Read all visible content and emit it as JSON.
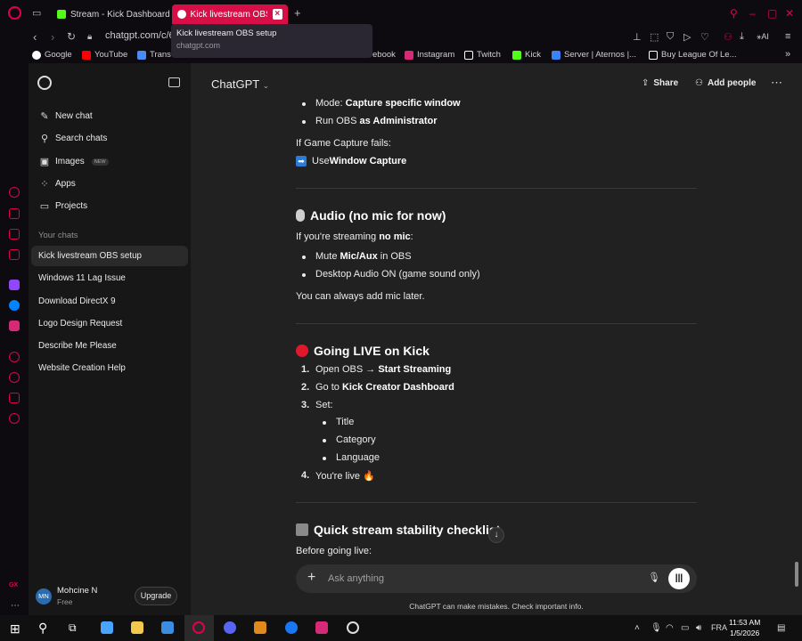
{
  "browser": {
    "tabs": [
      {
        "label": "Stream - Kick Dashboard",
        "favicon": "kick-icon",
        "color": "#53fc18"
      },
      {
        "label": "Kick livestream OBS se",
        "favicon": "chatgpt-icon",
        "active": true
      }
    ],
    "url": "chatgpt.com/c/6",
    "tooltip": {
      "title": "Kick livestream OBS setup",
      "domain": "chatgpt.com"
    },
    "bookmarks": [
      {
        "label": "Google",
        "icon": "google-icon",
        "color": "#ffffff"
      },
      {
        "label": "YouTube",
        "icon": "youtube-icon",
        "color": "#ff0000"
      },
      {
        "label": "Trans",
        "icon": "translate-icon",
        "color": "#4a8af4"
      },
      {
        "label": "ebook",
        "icon": "facebook-icon",
        "color": "#1877f2"
      },
      {
        "label": "Instagram",
        "icon": "instagram-icon",
        "color": "#d62976"
      },
      {
        "label": "Twitch",
        "icon": "twitch-icon",
        "color": "#ffffff"
      },
      {
        "label": "Kick",
        "icon": "kick-icon",
        "color": "#53fc18"
      },
      {
        "label": "Server | Aternos |...",
        "icon": "aternos-icon",
        "color": "#3b82f6"
      },
      {
        "label": "Buy League Of Le...",
        "icon": "shop-icon",
        "color": "#ffffff"
      }
    ],
    "accent": "#e0004d"
  },
  "sidebar": {
    "menu": [
      {
        "label": "New chat",
        "icon": "edit-icon"
      },
      {
        "label": "Search chats",
        "icon": "search-icon"
      },
      {
        "label": "Images",
        "icon": "image-icon",
        "badge": "NEW"
      },
      {
        "label": "Apps",
        "icon": "apps-icon"
      },
      {
        "label": "Projects",
        "icon": "folder-icon"
      }
    ],
    "section_title": "Your chats",
    "chats": [
      "Kick livestream OBS setup",
      "Windows 11 Lag Issue",
      "Download DirectX 9",
      "Logo Design Request",
      "Describe Me Please",
      "Website Creation Help"
    ],
    "user": {
      "initials": "MN",
      "name": "Mohcine N",
      "plan": "Free",
      "upgrade": "Upgrade"
    }
  },
  "header": {
    "model": "ChatGPT",
    "share": "Share",
    "add_people": "Add people"
  },
  "message": {
    "top_bullets": [
      {
        "pre": "Mode: ",
        "bold": "Capture specific window"
      },
      {
        "pre": "Run OBS ",
        "bold": "as Administrator"
      }
    ],
    "fallback_intro": "If Game Capture fails:",
    "fallback": {
      "icon": "➡",
      "pre": "Use ",
      "bold": "Window Capture"
    },
    "audio": {
      "heading": "Audio (no mic for now)",
      "intro_pre": "If you're streaming ",
      "intro_bold": "no mic",
      "intro_post": ":",
      "bullets": [
        {
          "pre": "Mute ",
          "bold": "Mic/Aux",
          "post": " in OBS"
        },
        {
          "pre": "Desktop Audio ON (game sound only)",
          "bold": "",
          "post": ""
        }
      ],
      "note": "You can always add mic later."
    },
    "live": {
      "heading": "Going LIVE on Kick",
      "steps": [
        {
          "n": "1.",
          "pre": "Open OBS → ",
          "bold": "Start Streaming"
        },
        {
          "n": "2.",
          "pre": "Go to ",
          "bold": "Kick Creator Dashboard"
        },
        {
          "n": "3.",
          "pre": "Set:",
          "bold": ""
        },
        {
          "n": "4.",
          "pre": "You're live 🔥",
          "bold": ""
        }
      ],
      "sub": [
        "Title",
        "Category",
        "Language"
      ]
    },
    "checklist": {
      "heading": "Quick stream stability checklist",
      "intro": "Before going live:"
    }
  },
  "composer": {
    "placeholder": "Ask anything"
  },
  "disclaimer": "ChatGPT can make mistakes. Check important info.",
  "taskbar": {
    "lang": "FRA",
    "time": "11:53 AM",
    "date": "1/5/2026"
  }
}
